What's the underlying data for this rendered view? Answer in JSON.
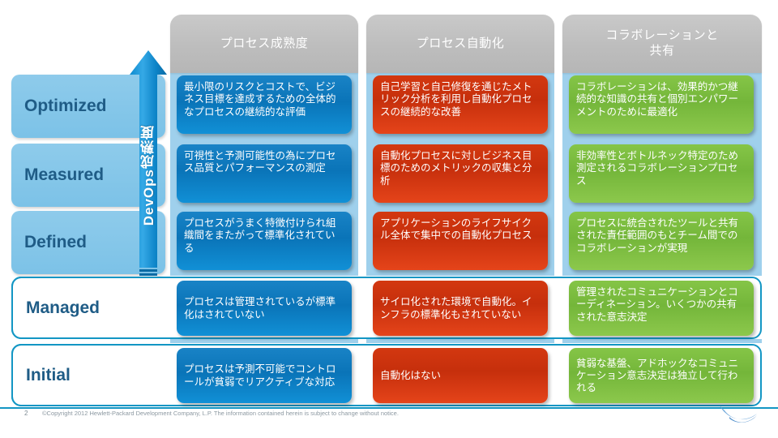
{
  "slide": {
    "vertical_axis_label": "DevOps成熟度",
    "footer_page_number": "2",
    "footer_copyright": "©Copyright 2012 Hewlett-Packard Development Company, L.P. The information contained herein is subject to change without notice.",
    "logo": "hp-swirl-logo"
  },
  "colors": {
    "blue": "#0f7fc4",
    "light_blue": "#7fc3e8",
    "red": "#df3a14",
    "green": "#7ac143",
    "grey_header": "#bdbdbd",
    "accent_teal": "#1396c4",
    "label_text": "#1f5c86"
  },
  "columns": [
    {
      "id": "process-maturity",
      "label": "プロセス成熟度"
    },
    {
      "id": "process-automation",
      "label": "プロセス自動化"
    },
    {
      "id": "collaboration",
      "label": "コラボレーションと\n共有"
    }
  ],
  "rows": [
    {
      "id": "optimized",
      "label": "Optimized",
      "style": "fill",
      "cells": [
        {
          "color": "blue",
          "text": "最小限のリスクとコストで、ビジネス目標を達成するための全体的なプロセスの継続的な評価"
        },
        {
          "color": "red",
          "text": "自己学習と自己修復を通じたメトリック分析を利用し自動化プロセスの継続的な改善"
        },
        {
          "color": "green",
          "text": "コラボレーションは、効果的かつ継続的な知識の共有と個別エンパワーメントのために最適化"
        }
      ]
    },
    {
      "id": "measured",
      "label": "Measured",
      "style": "fill",
      "cells": [
        {
          "color": "blue",
          "text": "可視性と予測可能性の為にプロセス品質とパフォーマンスの測定"
        },
        {
          "color": "red",
          "text": "自動化プロセスに対しビジネス目標のためのメトリックの収集と分析"
        },
        {
          "color": "green",
          "text": "非効率性とボトルネック特定のため測定されるコラボレーションプロセス"
        }
      ]
    },
    {
      "id": "defined",
      "label": "Defined",
      "style": "fill",
      "cells": [
        {
          "color": "blue",
          "text": "プロセスがうまく特徴付けられ組織間をまたがって標準化されている"
        },
        {
          "color": "red",
          "text": "アプリケーションのライフサイクル全体で集中での自動化プロセス"
        },
        {
          "color": "green",
          "text": "プロセスに統合されたツールと共有された責任範囲のもとチーム間でのコラボレーションが実現"
        }
      ]
    },
    {
      "id": "managed",
      "label": "Managed",
      "style": "hollow",
      "cells": [
        {
          "color": "blue",
          "text": "プロセスは管理されているが標準化はされていない"
        },
        {
          "color": "red",
          "text": "サイロ化された環境で自動化。インフラの標準化もされていない"
        },
        {
          "color": "green",
          "text": "管理されたコミュニケーションとコーディネーション。いくつかの共有された意志決定"
        }
      ]
    },
    {
      "id": "initial",
      "label": "Initial",
      "style": "hollow",
      "cells": [
        {
          "color": "blue",
          "text": "プロセスは予測不可能でコントロールが貧弱でリアクティブな対応"
        },
        {
          "color": "red",
          "text": "自動化はない"
        },
        {
          "color": "green",
          "text": "貧弱な基盤、アドホックなコミュニケーション意志決定は独立して行われる"
        }
      ]
    }
  ]
}
